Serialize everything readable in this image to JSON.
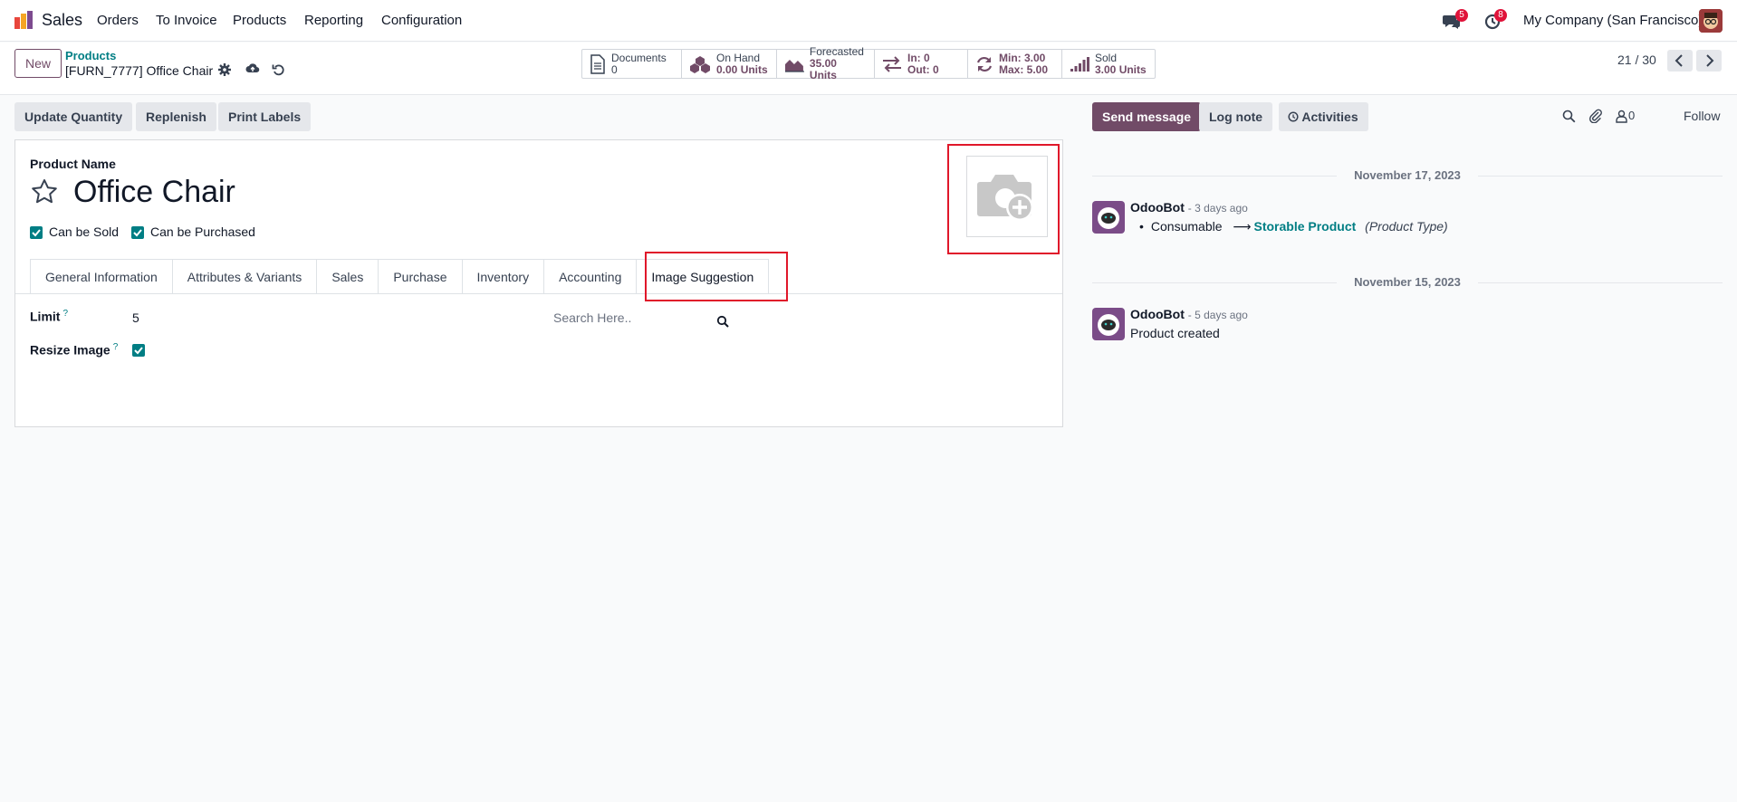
{
  "nav": {
    "app_name": "Sales",
    "menu": [
      "Orders",
      "To Invoice",
      "Products",
      "Reporting",
      "Configuration"
    ],
    "messages_count": "5",
    "activities_count": "8",
    "company": "My Company (San Francisco)"
  },
  "control": {
    "new_label": "New",
    "breadcrumb_parent": "Products",
    "breadcrumb_current": "[FURN_7777] Office Chair",
    "stats": [
      {
        "icon": "document-icon",
        "label": "Documents",
        "value": "0"
      },
      {
        "icon": "cubes-icon",
        "label": "On Hand",
        "value": "0.00 Units"
      },
      {
        "icon": "area-chart-icon",
        "label": "Forecasted",
        "value": "35.00 Units"
      },
      {
        "icon": "exchange-icon",
        "label": "In: 0",
        "value": "Out: 0"
      },
      {
        "icon": "refresh-icon",
        "label": "Min: 3.00",
        "value": "Max: 5.00"
      },
      {
        "icon": "signal-icon",
        "label": "Sold",
        "value": "3.00 Units"
      }
    ],
    "pager": "21 / 30"
  },
  "actions": [
    "Update Quantity",
    "Replenish",
    "Print Labels"
  ],
  "form": {
    "product_name_label": "Product Name",
    "product_name": "Office Chair",
    "can_be_sold": "Can be Sold",
    "can_be_purchased": "Can be Purchased",
    "tabs": [
      "General Information",
      "Attributes & Variants",
      "Sales",
      "Purchase",
      "Inventory",
      "Accounting",
      "Image Suggestion"
    ],
    "active_tab": "Image Suggestion",
    "limit_label": "Limit",
    "limit_value": "5",
    "resize_label": "Resize Image",
    "help_mark": "?",
    "search_placeholder": "Search Here.."
  },
  "chatter": {
    "send_message": "Send message",
    "log_note": "Log note",
    "activities": "Activities",
    "followers_count": "0",
    "follow": "Follow",
    "entries": [
      {
        "date": "November 17, 2023",
        "author": "OdooBot",
        "time": "- 3 days ago",
        "old_value": "Consumable",
        "new_value": "Storable Product",
        "field": "(Product Type)"
      },
      {
        "date": "November 15, 2023",
        "author": "OdooBot",
        "time": "- 5 days ago",
        "body": "Product created"
      }
    ]
  },
  "colors": {
    "brand": "#714b67",
    "teal": "#017e84",
    "highlight": "#e0172a"
  }
}
